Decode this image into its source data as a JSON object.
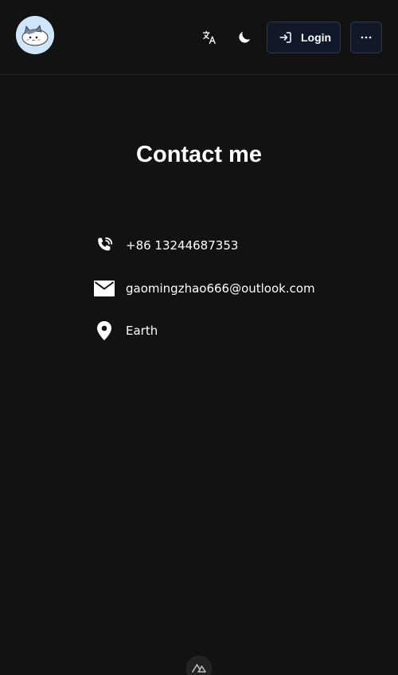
{
  "header": {
    "avatar_alt": "cat avatar",
    "translate_icon": "translate-icon",
    "theme_icon": "moon-icon",
    "login_label": "Login",
    "login_icon": "login-arrow-icon",
    "more_icon": "ellipsis-icon"
  },
  "main": {
    "title": "Contact me",
    "contacts": [
      {
        "icon": "phone-icon",
        "text": "+86 13244687353"
      },
      {
        "icon": "mail-icon",
        "text": "gaomingzhao666@outlook.com"
      },
      {
        "icon": "location-pin-icon",
        "text": "Earth"
      }
    ]
  },
  "footer": {
    "badge_icon": "nuxt-logo-icon"
  },
  "colors": {
    "background": "#121212",
    "text": "#ffffff",
    "button_bg": "#111827",
    "button_border": "#2f3646",
    "avatar_bg": "#cde6fb"
  }
}
